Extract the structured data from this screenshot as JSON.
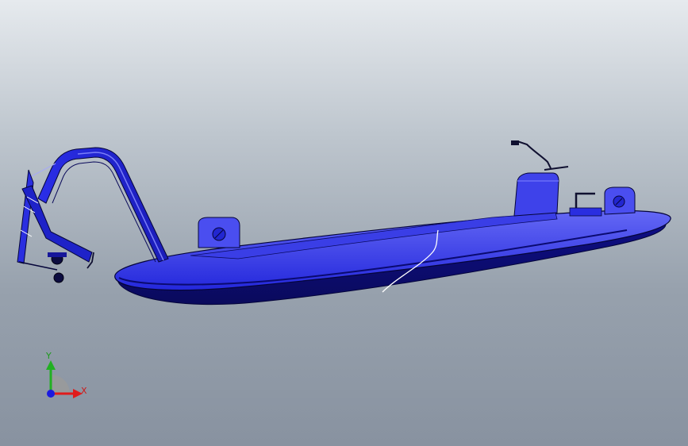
{
  "viewport": {
    "background_top": "#e6eaee",
    "background_bottom": "#8892a0"
  },
  "model": {
    "color_main": "#1e22d8",
    "color_light": "#5a5ef2",
    "color_dark": "#0c0c70",
    "color_edge": "#05053a"
  },
  "triad": {
    "x_label": "X",
    "y_label": "Y",
    "x_color": "#e01b1b",
    "y_color": "#22b022",
    "z_color": "#1a1ae0"
  }
}
